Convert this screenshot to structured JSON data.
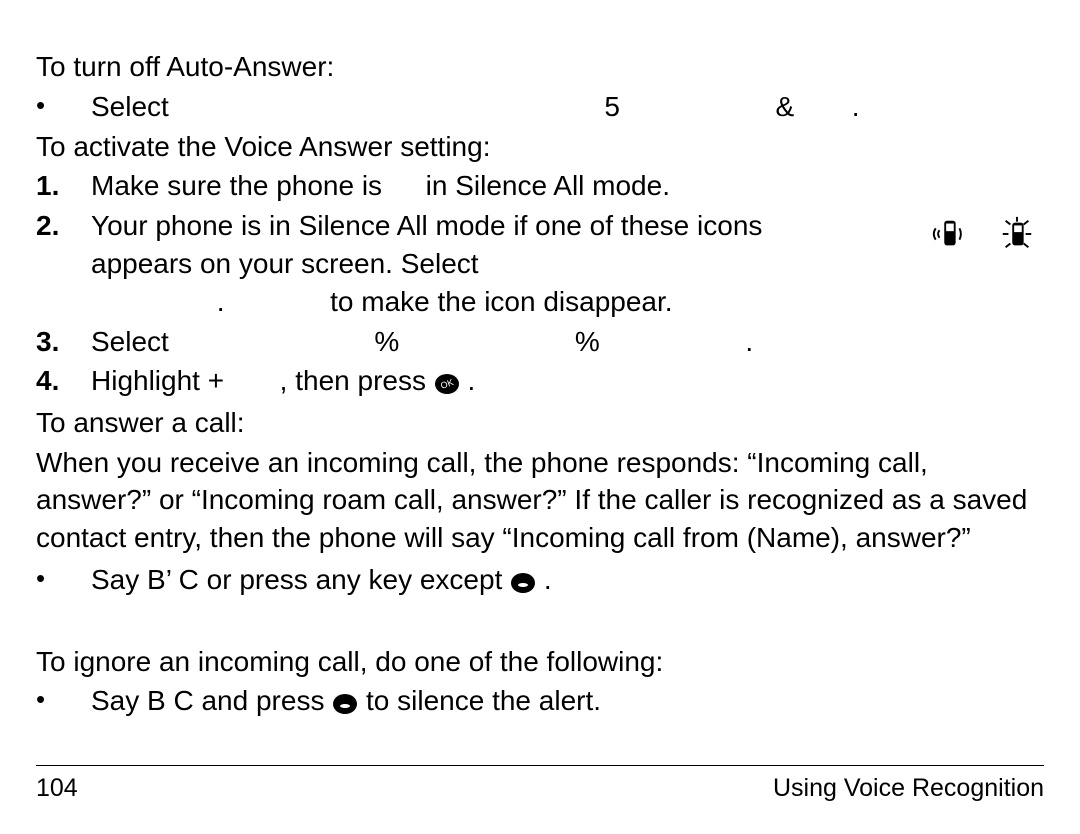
{
  "heading1": "To turn off Auto-Answer:",
  "auto_off": {
    "select": "Select",
    "five": "5",
    "amp": "&",
    "dot": "."
  },
  "heading2": "To activate the Voice Answer setting:",
  "step1": {
    "num": "1.",
    "a": "Make sure the phone is",
    "b": "in Silence All mode."
  },
  "step2": {
    "num": "2.",
    "line1": "Your phone is in Silence All mode if one of these icons",
    "line2": "appears on your screen. Select",
    "dot": ".",
    "tail": "to make the icon disappear."
  },
  "step3": {
    "num": "3.",
    "select": "Select",
    "pct1": "%",
    "pct2": "%",
    "dot": "."
  },
  "step4": {
    "num": "4.",
    "a": "Highlight +",
    "b": ", then press",
    "dot": "."
  },
  "heading3": "To answer a call:",
  "answer_para": "When you receive an incoming call, the phone responds: “Incoming call, answer?” or “Incoming roam call, answer?” If the caller is recognized as a saved contact entry, then the phone will say “Incoming call from (Name), answer?”",
  "answer_bullet": {
    "a": "Say B’  C  or press any key except",
    "dot": "."
  },
  "heading4": "To ignore an incoming call, do one of the following:",
  "ignore_bullet": {
    "a": "Say B  C and press",
    "b": "to silence the alert."
  },
  "footer": {
    "page": "104",
    "title": "Using Voice Recognition"
  }
}
